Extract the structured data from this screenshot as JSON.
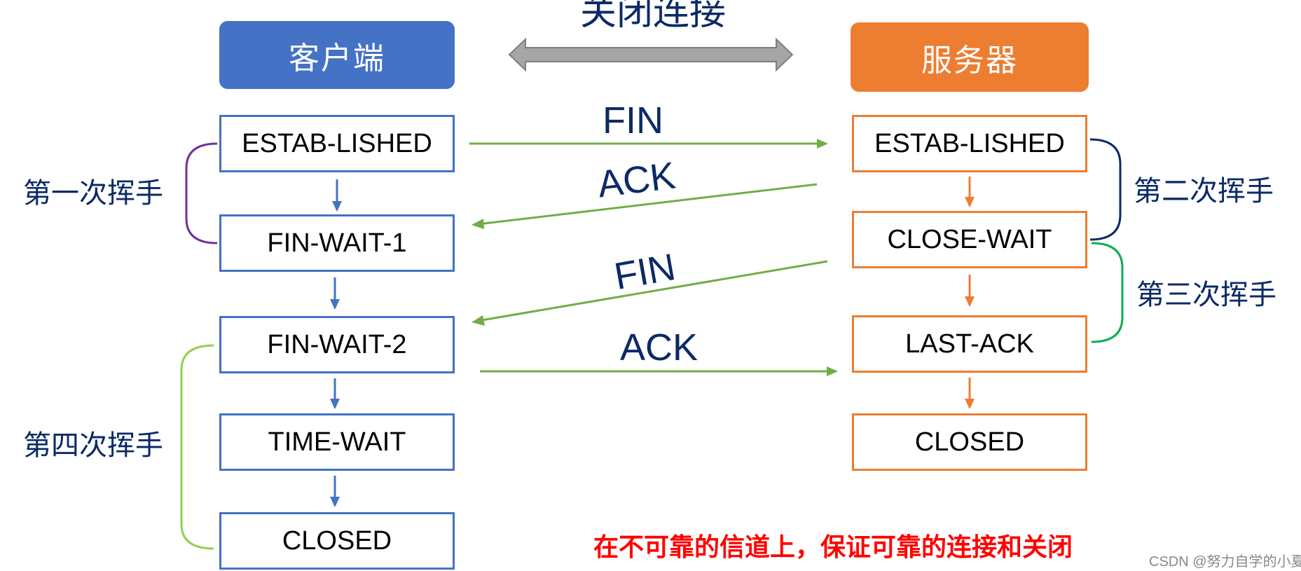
{
  "title": "关闭连接",
  "client": {
    "header": "客户端",
    "color": "#4472c4",
    "states": [
      "ESTAB-LISHED",
      "FIN-WAIT-1",
      "FIN-WAIT-2",
      "TIME-WAIT",
      "CLOSED"
    ]
  },
  "server": {
    "header": "服务器",
    "color": "#ed7d31",
    "states": [
      "ESTAB-LISHED",
      "CLOSE-WAIT",
      "LAST-ACK",
      "CLOSED"
    ]
  },
  "messages": [
    {
      "label": "FIN",
      "from": "client",
      "to": "server"
    },
    {
      "label": "ACK",
      "from": "server",
      "to": "client"
    },
    {
      "label": "FIN",
      "from": "server",
      "to": "client"
    },
    {
      "label": "ACK",
      "from": "client",
      "to": "server"
    }
  ],
  "waves": {
    "first": "第一次挥手",
    "second": "第二次挥手",
    "third": "第三次挥手",
    "fourth": "第四次挥手"
  },
  "colors": {
    "message_arrow": "#70ad47",
    "label_text": "#0b2a66",
    "bracket_first": "#7030a0",
    "bracket_second": "#0b2a66",
    "bracket_third": "#00b050",
    "bracket_fourth": "#92d050",
    "note_text": "#ff0000",
    "double_arrow": "#a6a6a6"
  },
  "note": "在不可靠的信道上，保证可靠的连接和关闭",
  "watermark": "CSDN @努力自学的小夏"
}
